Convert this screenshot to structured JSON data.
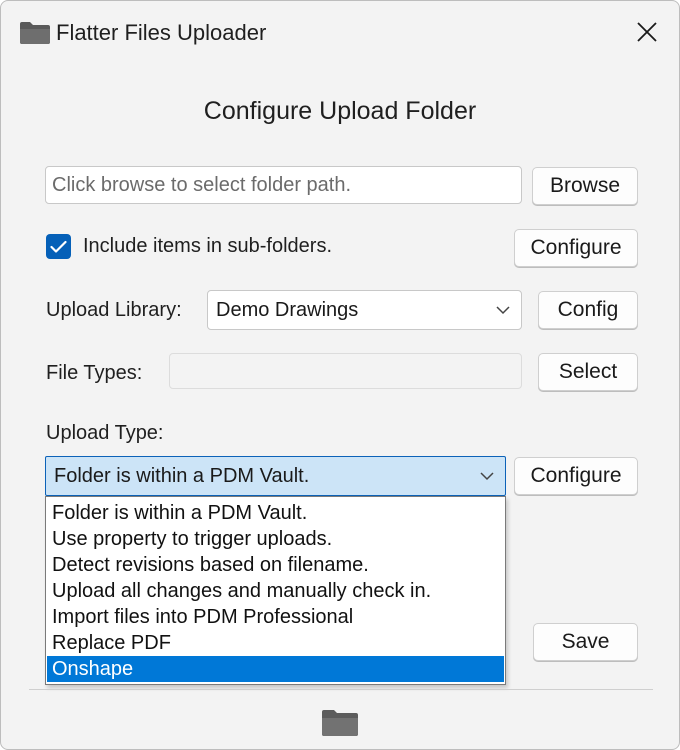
{
  "window": {
    "title": "Flatter Files Uploader"
  },
  "dialog": {
    "heading": "Configure Upload Folder",
    "folder_path": {
      "value": "",
      "placeholder": "Click browse to select folder path."
    },
    "browse_label": "Browse",
    "include_subfolders": {
      "label": "Include items in sub-folders.",
      "checked": true
    },
    "subfolders_configure_label": "Configure",
    "upload_library": {
      "label": "Upload Library:",
      "selected": "Demo Drawings",
      "config_label": "Config"
    },
    "file_types": {
      "label": "File Types:",
      "value": "",
      "select_label": "Select"
    },
    "upload_type": {
      "label": "Upload Type:",
      "selected": "Folder is within a PDM Vault.",
      "configure_label": "Configure",
      "options": [
        "Folder is within a PDM Vault.",
        "Use property to trigger uploads.",
        "Detect revisions based on filename.",
        "Upload all changes and manually check in.",
        "Import files into PDM Professional",
        "Replace PDF",
        "Onshape"
      ],
      "highlighted": "Onshape"
    },
    "save_label": "Save"
  },
  "icons": {
    "title": "folder-icon",
    "close": "close-icon",
    "checkbox": "checkmark-icon",
    "combo": "chevron-down-icon",
    "footer": "folder-icon"
  },
  "colors": {
    "accent": "#0078d7",
    "checkbox": "#0560b8",
    "combo_open_bg": "#cce4f7"
  }
}
